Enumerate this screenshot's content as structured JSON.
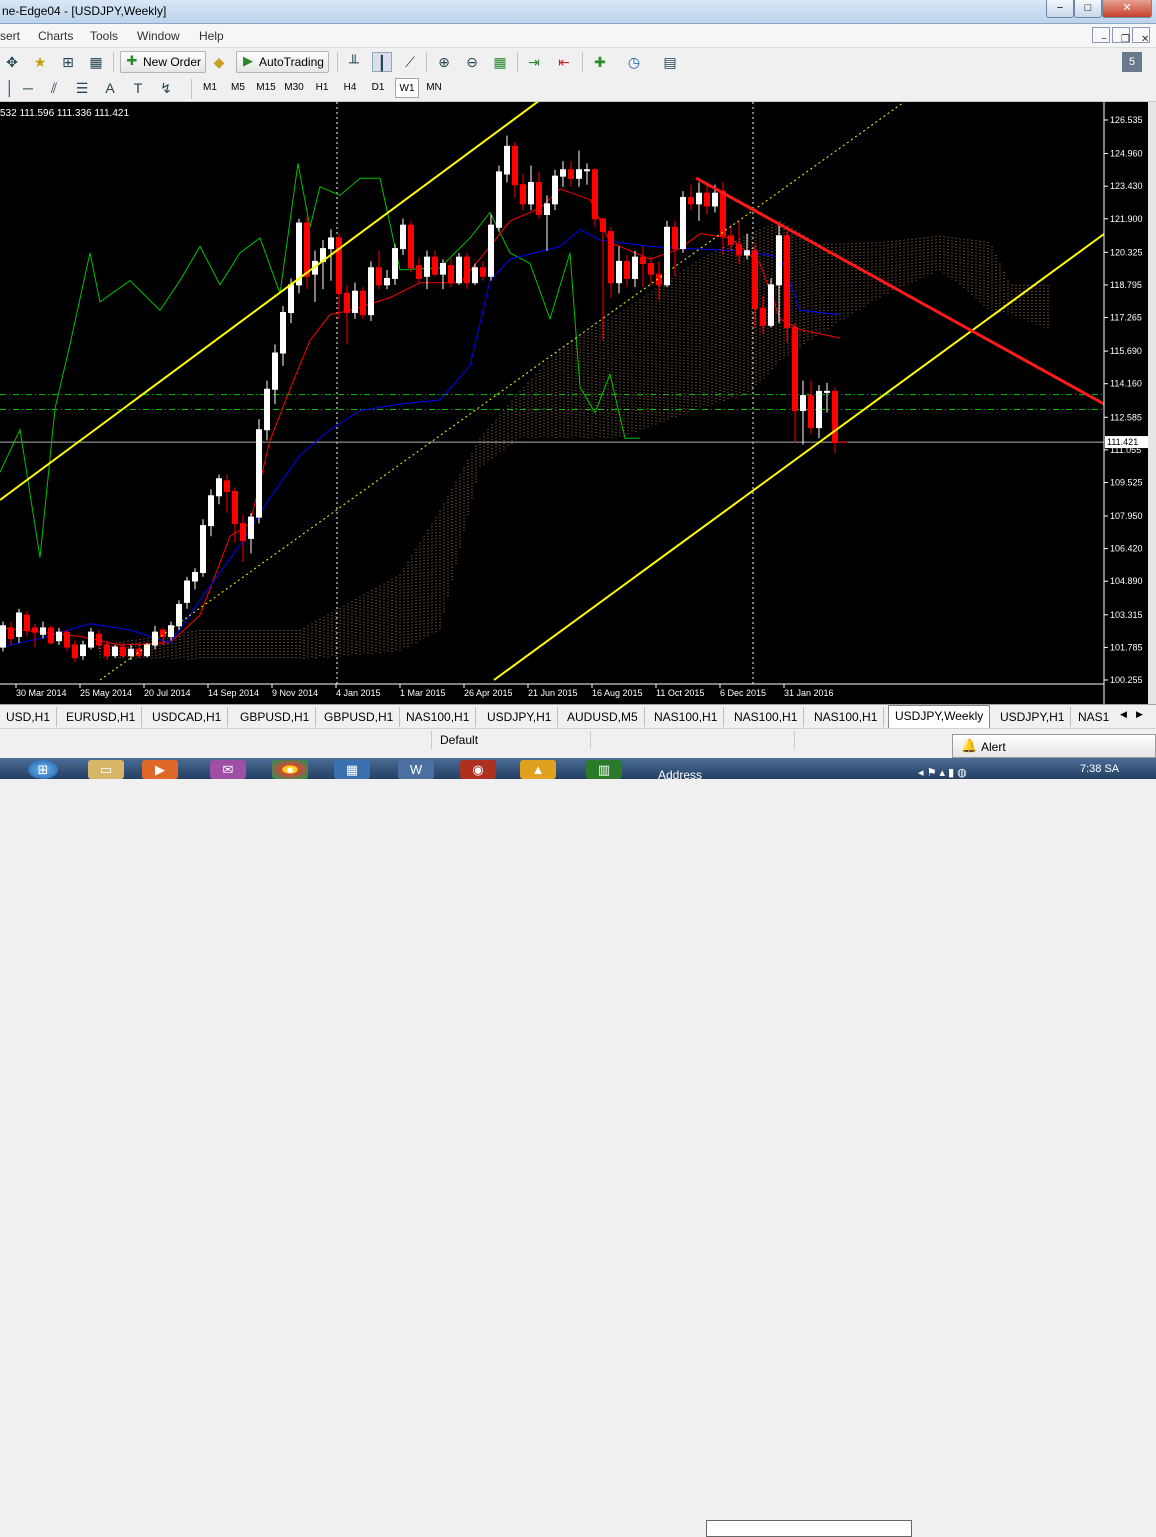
{
  "window": {
    "title": "ne-Edge04 - [USDJPY,Weekly]",
    "min": "−",
    "max": "□",
    "close": "✕"
  },
  "menu": [
    "sert",
    "Charts",
    "Tools",
    "Window",
    "Help"
  ],
  "mdi": {
    "min": "−",
    "restore": "❐",
    "close": "✕"
  },
  "toolbar": {
    "new_order": "New Order",
    "autotrading": "AutoTrading",
    "search_placeholder": ""
  },
  "timeframes": [
    "M1",
    "M5",
    "M15",
    "M30",
    "H1",
    "H4",
    "D1",
    "W1",
    "MN"
  ],
  "active_timeframe": "W1",
  "ohlc_readout": "532 111.596 111.336 111.421",
  "price_axis": [
    "126.535",
    "124.960",
    "123.430",
    "121.900",
    "120.325",
    "118.795",
    "117.265",
    "115.690",
    "114.160",
    "112.585",
    "111.055",
    "109.525",
    "107.950",
    "106.420",
    "104.890",
    "103.315",
    "101.785",
    "100.255"
  ],
  "current_price": "111.421",
  "date_axis": [
    "30 Mar 2014",
    "25 May 2014",
    "20 Jul 2014",
    "14 Sep 2014",
    "9 Nov 2014",
    "4 Jan 2015",
    "1 Mar 2015",
    "26 Apr 2015",
    "21 Jun 2015",
    "16 Aug 2015",
    "11 Oct 2015",
    "6 Dec 2015",
    "31 Jan 2016"
  ],
  "tabs": [
    "USD,H1",
    "EURUSD,H1",
    "USDCAD,H1",
    "GBPUSD,H1",
    "GBPUSD,H1",
    "NAS100,H1",
    "USDJPY,H1",
    "AUDUSD,M5",
    "NAS100,H1",
    "NAS100,H1",
    "NAS100,H1",
    "USDJPY,Weekly",
    "USDJPY,H1",
    "NAS1"
  ],
  "active_tab": "USDJPY,Weekly",
  "status": {
    "profile": "Default"
  },
  "alert": {
    "label": "Alert"
  },
  "taskbar": {
    "address_label": "Address",
    "clock": "7:38 SA"
  },
  "colors": {
    "chart_bg": "#000000",
    "bull": "#ffffff",
    "bear": "#ff0000",
    "trendline": "#ff1a1a",
    "channel": "#ffff00",
    "kijun": "#0000ff",
    "tenkan": "#ff0000",
    "chikou": "#00c000",
    "cloud": "#e39b6a"
  }
}
